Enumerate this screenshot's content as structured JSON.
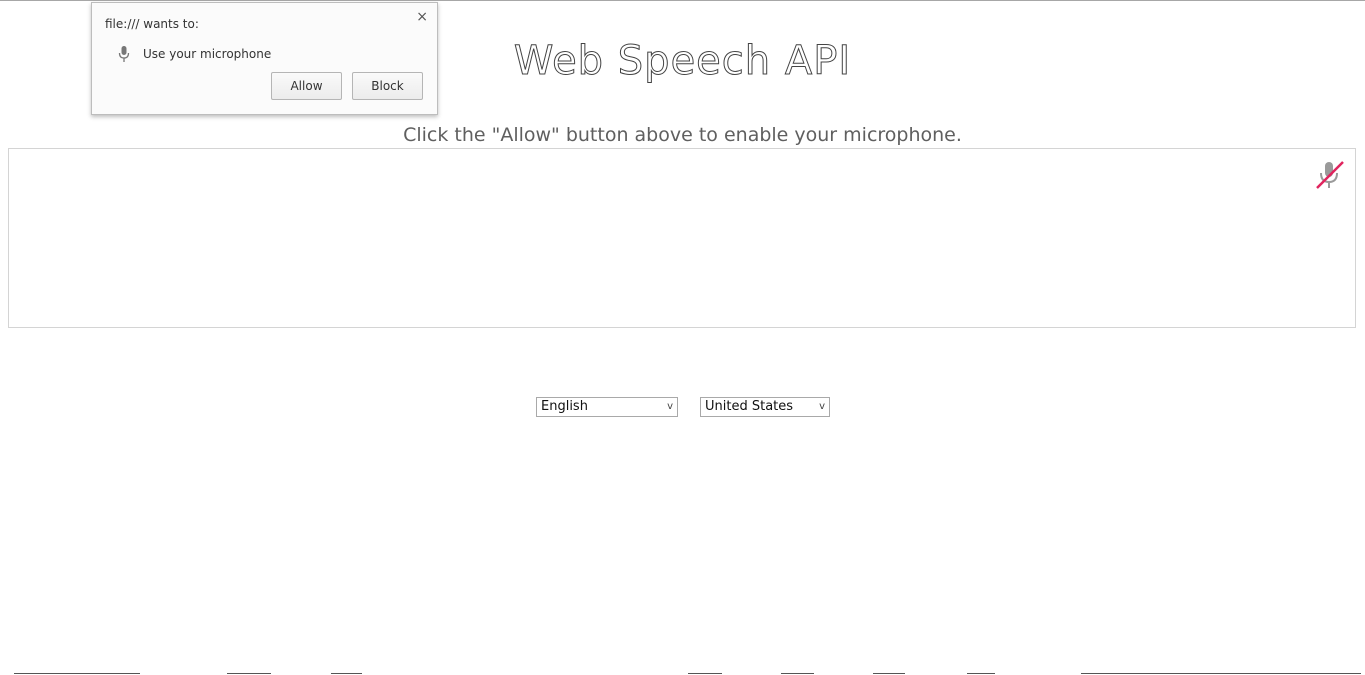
{
  "page": {
    "title": "Web Speech API",
    "info": "Click the \"Allow\" button above to enable your microphone."
  },
  "mic_button": {
    "icon": "mic-slash-icon",
    "state": "disabled"
  },
  "language": {
    "selected": "English"
  },
  "dialect": {
    "selected": "United States"
  },
  "permission_prompt": {
    "origin_text": "file:/// wants to:",
    "request_icon": "microphone-icon",
    "request_text": "Use your microphone",
    "allow_label": "Allow",
    "block_label": "Block",
    "close_label": "×"
  },
  "colors": {
    "mic_slash": "#e0245e",
    "mic_body": "#9a9a9a"
  }
}
